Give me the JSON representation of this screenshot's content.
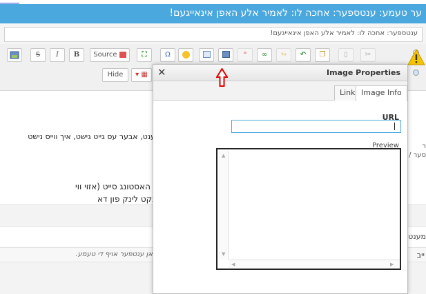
{
  "window": {
    "top_text": "ער טעמע: ענטספער: אחכה לו: לאמיר אלע האפן אינאייגעם!",
    "subject_value": "ענטספער: אחכה לו: לאמיר אלע האפן אינאייגעם!"
  },
  "toolbar": {
    "source_label": "Source",
    "hide_label": "Hide",
    "bold_label": "B",
    "italic_label": "I",
    "strike_label": "S",
    "omega_label": "Ω"
  },
  "editor": {
    "line1": "ענט, אבער עס גייט גישט, איך ווייס נישט",
    "line2": "ן האסטונג סייט (אזוי ווי",
    "line3": "נקט לינק פון דא",
    "left_fragment1": "ר",
    "left_fragment2": "סער /",
    "lower_fragment": "מענט",
    "reply_placeholder": "אן ענטפער אויף די טעמע.",
    "reply_side": "ייב"
  },
  "dialog": {
    "title": "Image Properties",
    "close_glyph": "✕",
    "tabs": [
      {
        "label": "Link",
        "active": false
      },
      {
        "label": "Image Info",
        "active": true
      }
    ],
    "url_label": "URL",
    "url_value": "",
    "preview_label": "Preview"
  },
  "colors": {
    "title_bar": "#4aa8de",
    "arrow": "#e00000",
    "warning": "#f5c400"
  },
  "icons": [
    "image-icon",
    "strike-icon",
    "italic-icon",
    "bold-icon",
    "source-icon",
    "maximize-icon",
    "omega-icon",
    "smiley-icon",
    "table-icon",
    "image-insert-icon",
    "quote-icon",
    "link-icon",
    "unlink-icon",
    "undo-icon",
    "paste-icon",
    "warning-icon"
  ]
}
